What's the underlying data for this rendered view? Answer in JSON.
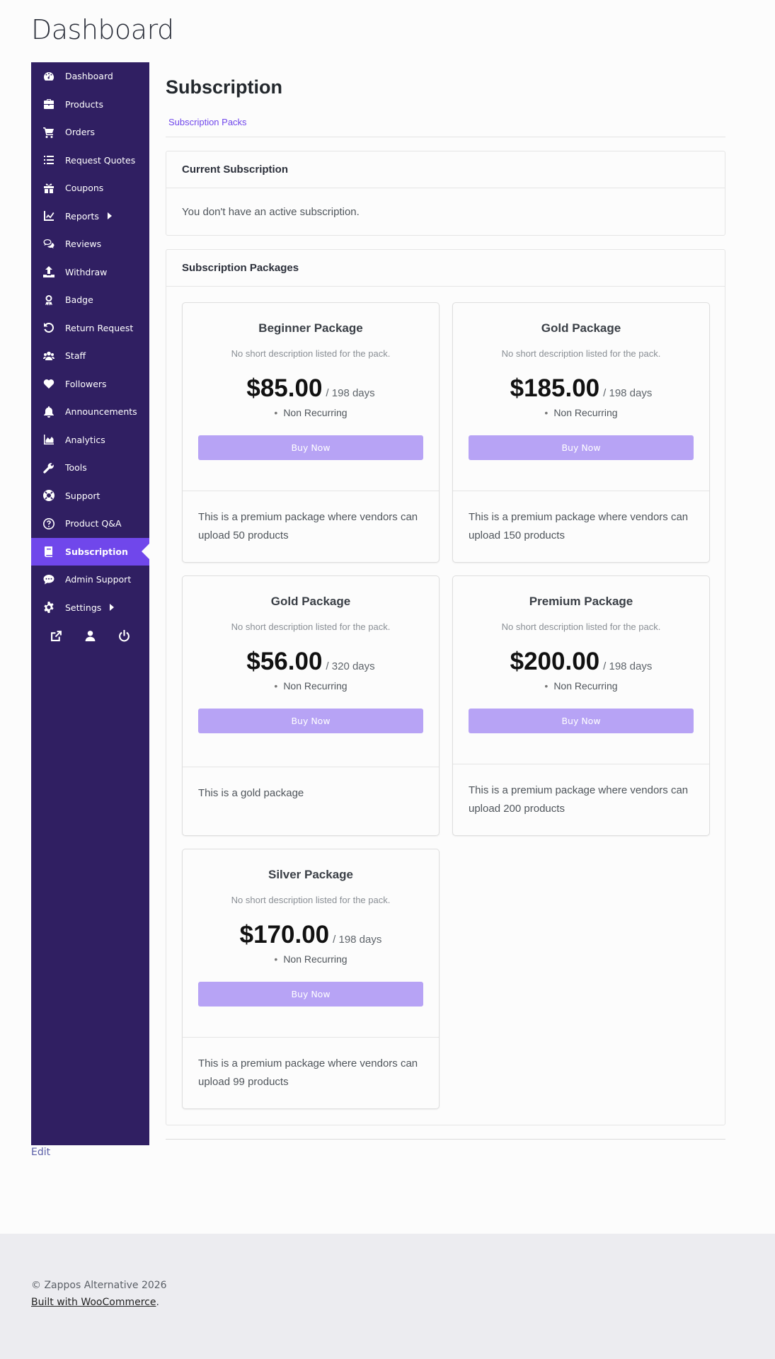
{
  "page": {
    "title": "Dashboard"
  },
  "sidebar": {
    "items": [
      {
        "label": "Dashboard",
        "icon": "dashboard-gauge-icon"
      },
      {
        "label": "Products",
        "icon": "briefcase-icon"
      },
      {
        "label": "Orders",
        "icon": "cart-icon"
      },
      {
        "label": "Request Quotes",
        "icon": "list-icon"
      },
      {
        "label": "Coupons",
        "icon": "gift-icon"
      },
      {
        "label": "Reports",
        "icon": "line-chart-icon",
        "has_submenu": true
      },
      {
        "label": "Reviews",
        "icon": "chat-bubbles-icon"
      },
      {
        "label": "Withdraw",
        "icon": "upload-icon"
      },
      {
        "label": "Badge",
        "icon": "award-icon"
      },
      {
        "label": "Return Request",
        "icon": "undo-icon"
      },
      {
        "label": "Staff",
        "icon": "users-icon"
      },
      {
        "label": "Followers",
        "icon": "heart-icon"
      },
      {
        "label": "Announcements",
        "icon": "bell-icon"
      },
      {
        "label": "Analytics",
        "icon": "area-chart-icon"
      },
      {
        "label": "Tools",
        "icon": "wrench-icon"
      },
      {
        "label": "Support",
        "icon": "lifebuoy-icon"
      },
      {
        "label": "Product Q&A",
        "icon": "question-circle-icon"
      },
      {
        "label": "Subscription",
        "icon": "book-icon",
        "active": true
      },
      {
        "label": "Admin Support",
        "icon": "comment-dots-icon"
      },
      {
        "label": "Settings",
        "icon": "gear-icon",
        "has_submenu": true
      }
    ],
    "bottom_icons": [
      "external-link-icon",
      "user-icon",
      "power-icon"
    ],
    "colors": {
      "background": "#301f62",
      "active": "#7047eb"
    }
  },
  "edit_link": "Edit",
  "main": {
    "title": "Subscription",
    "subnav_link": "Subscription Packs",
    "current": {
      "heading": "Current Subscription",
      "message": "You don't have an active subscription."
    },
    "packages": {
      "heading": "Subscription Packages",
      "buy_label": "Buy Now",
      "items": [
        {
          "name": "Beginner Package",
          "desc": "No short description listed for the pack.",
          "price": "$85.00",
          "period": "/ 198 days",
          "recurring": "Non Recurring",
          "details": "This is a premium package where vendors can upload 50 products"
        },
        {
          "name": "Gold Package",
          "desc": "No short description listed for the pack.",
          "price": "$185.00",
          "period": "/ 198 days",
          "recurring": "Non Recurring",
          "details": "This is a premium package where vendors can upload 150 products"
        },
        {
          "name": "Gold Package",
          "desc": "No short description listed for the pack.",
          "price": "$56.00",
          "period": "/ 320 days",
          "recurring": "Non Recurring",
          "details": "This is a gold package"
        },
        {
          "name": "Premium Package",
          "desc": "No short description listed for the pack.",
          "price": "$200.00",
          "period": "/ 198 days",
          "recurring": "Non Recurring",
          "details": "This is a premium package where vendors can upload 200 products"
        },
        {
          "name": "Silver Package",
          "desc": "No short description listed for the pack.",
          "price": "$170.00",
          "period": "/ 198 days",
          "recurring": "Non Recurring",
          "details": "This is a premium package where vendors can upload 99 products"
        }
      ]
    }
  },
  "footer": {
    "copyright": "© Zappos Alternative 2026",
    "built_link": "Built with WooCommerce",
    "built_suffix": "."
  }
}
